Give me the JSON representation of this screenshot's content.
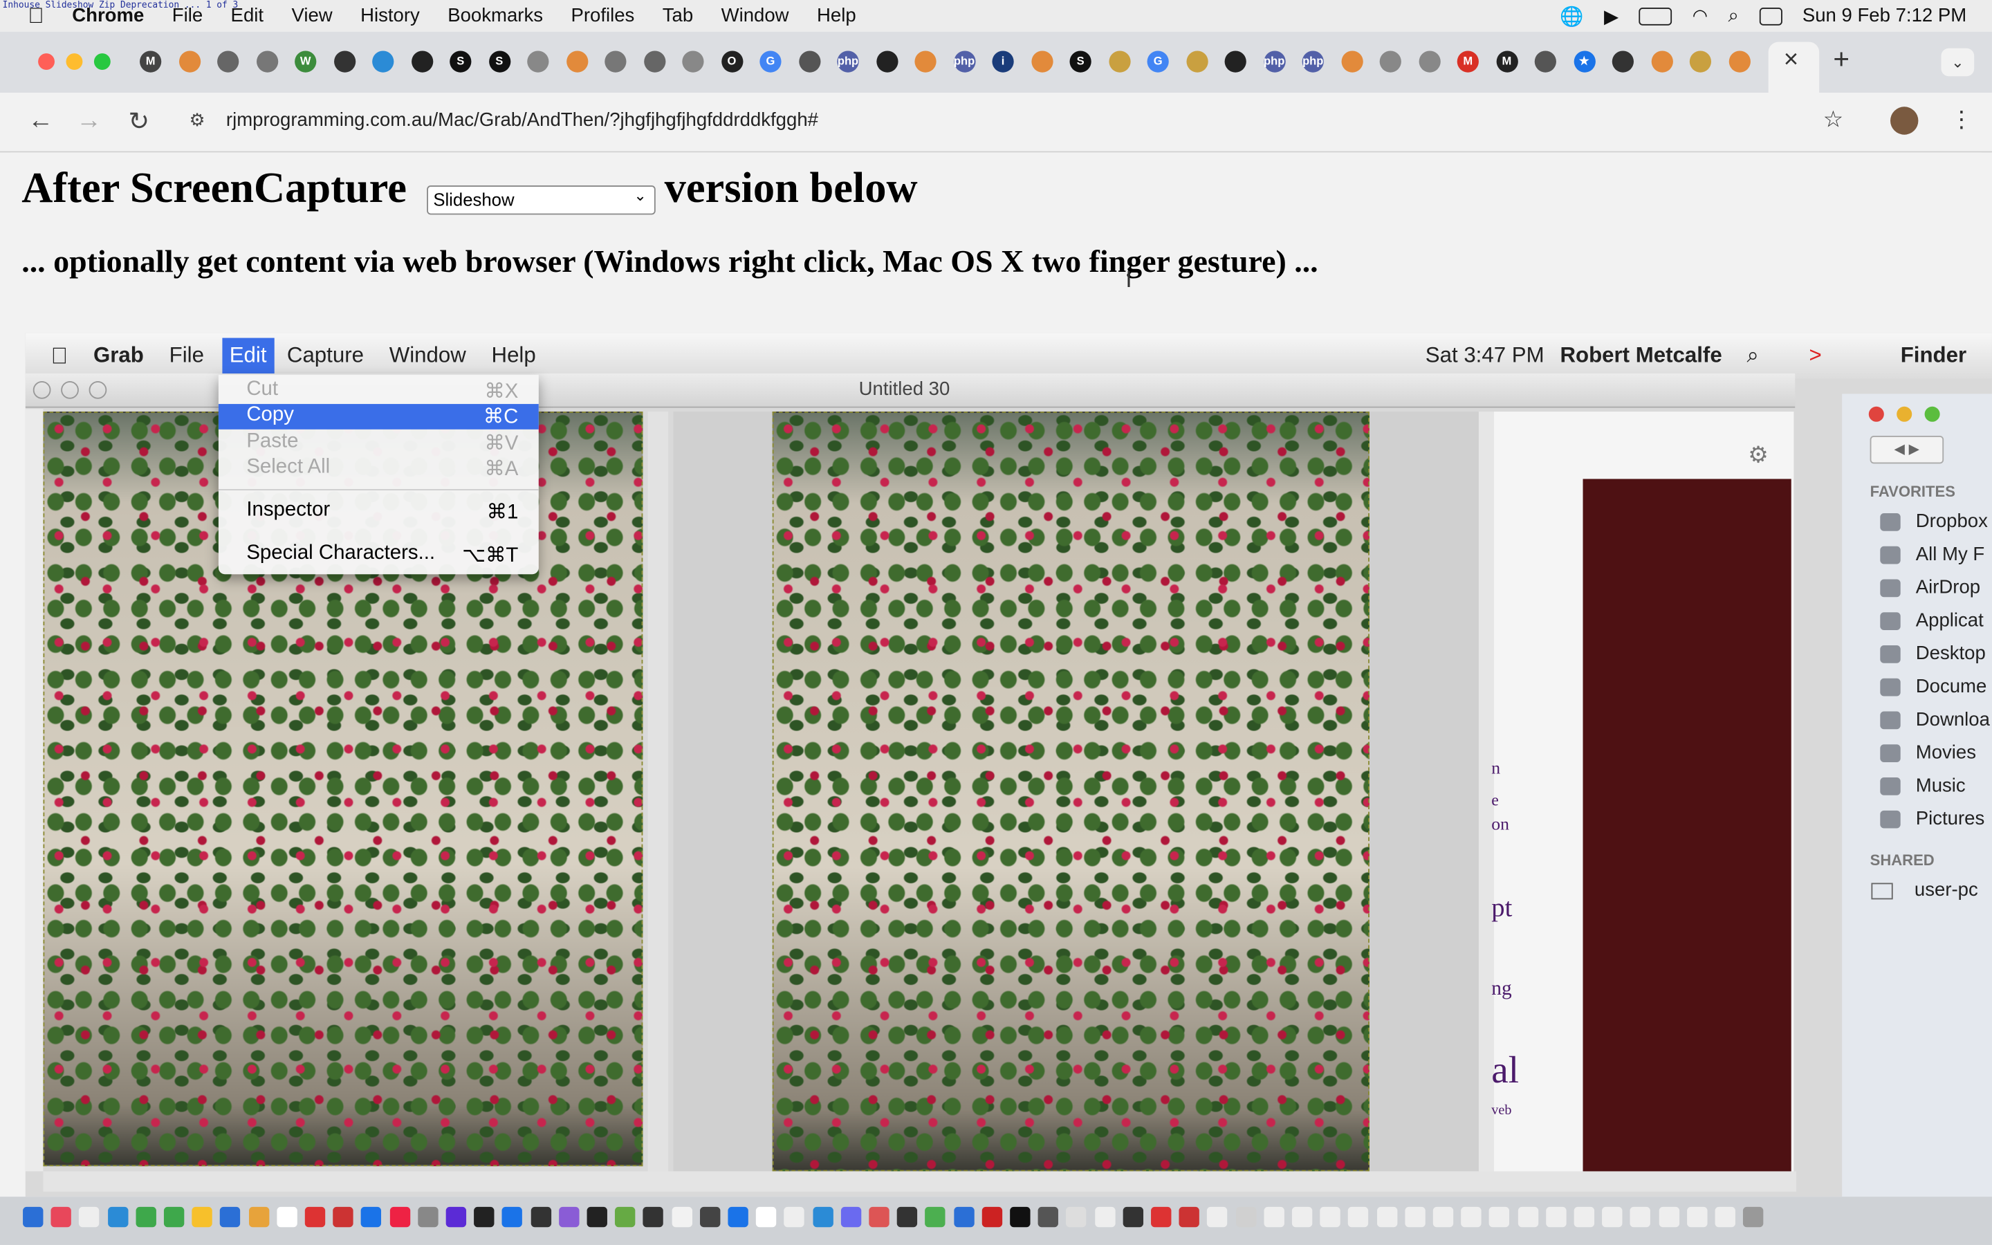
{
  "menubar": {
    "app": "Chrome",
    "items": [
      "File",
      "Edit",
      "View",
      "History",
      "Bookmarks",
      "Profiles",
      "Tab",
      "Window",
      "Help"
    ],
    "datetime": "Sun 9 Feb  7:12 PM",
    "tiny_title": "Inhouse Slideshow Zip Deprecation ... 1 of 3"
  },
  "browser": {
    "url": "rjmprogramming.com.au/Mac/Grab/AndThen/?jhgfjhgfjhgfddrddkfggh#",
    "close_tab": "×",
    "new_tab": "+",
    "favicons": [
      "M",
      "",
      "",
      "",
      "W",
      "",
      "",
      "",
      "S",
      "S",
      "",
      "",
      "",
      "",
      "",
      "O",
      "G",
      "",
      "php",
      "",
      "",
      "php",
      "i",
      "",
      "S",
      "",
      "G",
      "",
      "",
      "php",
      "php",
      "",
      "",
      "",
      "M",
      "M",
      "",
      "★",
      "",
      "",
      "",
      ""
    ]
  },
  "page": {
    "heading_before": "After ScreenCapture",
    "select_value": "Slideshow",
    "heading_after": "version below",
    "subheading": "... optionally get content via web browser (Windows right click, Mac OS X two finger gesture) ..."
  },
  "embedded": {
    "app": "Grab",
    "menu": [
      "File",
      "Edit",
      "Capture",
      "Window",
      "Help"
    ],
    "datetime": "Sat 3:47 PM",
    "user": "Robert Metcalfe",
    "finder_label": "Finder",
    "window_title": "Untitled 30",
    "edit_menu": [
      {
        "label": "Cut",
        "shortcut": "⌘X",
        "state": "disabled"
      },
      {
        "label": "Copy",
        "shortcut": "⌘C",
        "state": "highlighted"
      },
      {
        "label": "Paste",
        "shortcut": "⌘V",
        "state": "disabled"
      },
      {
        "label": "Select All",
        "shortcut": "⌘A",
        "state": "disabled"
      },
      {
        "label": "Inspector",
        "shortcut": "⌘1",
        "state": "enabled"
      },
      {
        "label": "Special Characters...",
        "shortcut": "⌥⌘T",
        "state": "enabled"
      }
    ],
    "favorites_header": "FAVORITES",
    "favorites": [
      "Dropbox",
      "All My F",
      "AirDrop",
      "Applicat",
      "Desktop",
      "Docume",
      "Downloa",
      "Movies",
      "Music",
      "Pictures"
    ],
    "shared_header": "SHARED",
    "shared": [
      "user-pc"
    ],
    "partial_text": [
      "n",
      "e",
      "on",
      "pt",
      "ng",
      "al",
      "veb"
    ]
  },
  "colors": {
    "highlight": "#3a6ee8",
    "dark_panel": "#4e1113",
    "link_purple": "#4b1a6b"
  }
}
